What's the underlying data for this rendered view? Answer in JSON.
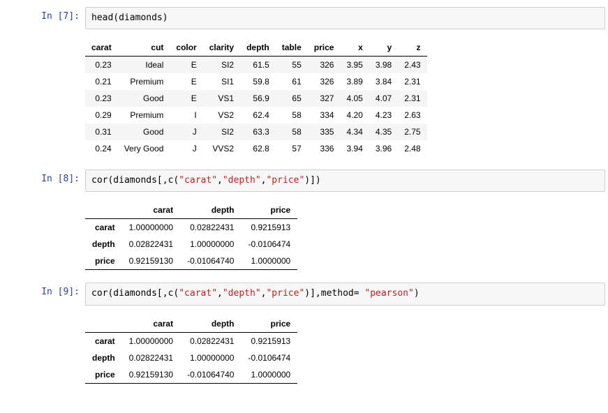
{
  "cells": [
    {
      "prompt": "In  [7]:",
      "code_plain": "head(diamonds)",
      "code_html": "head(diamonds)",
      "output_kind": "df",
      "df": {
        "headers": [
          "carat",
          "cut",
          "color",
          "clarity",
          "depth",
          "table",
          "price",
          "x",
          "y",
          "z"
        ],
        "rows": [
          [
            "0.23",
            "Ideal",
            "E",
            "SI2",
            "61.5",
            "55",
            "326",
            "3.95",
            "3.98",
            "2.43"
          ],
          [
            "0.21",
            "Premium",
            "E",
            "SI1",
            "59.8",
            "61",
            "326",
            "3.89",
            "3.84",
            "2.31"
          ],
          [
            "0.23",
            "Good",
            "E",
            "VS1",
            "56.9",
            "65",
            "327",
            "4.05",
            "4.07",
            "2.31"
          ],
          [
            "0.29",
            "Premium",
            "I",
            "VS2",
            "62.4",
            "58",
            "334",
            "4.20",
            "4.23",
            "2.63"
          ],
          [
            "0.31",
            "Good",
            "J",
            "SI2",
            "63.3",
            "58",
            "335",
            "4.34",
            "4.35",
            "2.75"
          ],
          [
            "0.24",
            "Very Good",
            "J",
            "VVS2",
            "62.8",
            "57",
            "336",
            "3.94",
            "3.96",
            "2.48"
          ]
        ]
      }
    },
    {
      "prompt": "In  [8]:",
      "code_plain": "cor(diamonds[,c(\"carat\",\"depth\",\"price\")])",
      "code_html": "cor(diamonds[,c(<span class=\"code-str\">\"carat\"</span>,<span class=\"code-str\">\"depth\"</span>,<span class=\"code-str\">\"price\"</span>)])",
      "output_kind": "cor",
      "cor": {
        "headers": [
          "carat",
          "depth",
          "price"
        ],
        "rows": [
          {
            "label": "carat",
            "values": [
              "1.00000000",
              "0.02822431",
              "0.9215913"
            ]
          },
          {
            "label": "depth",
            "values": [
              "0.02822431",
              "1.00000000",
              "-0.0106474"
            ]
          },
          {
            "label": "price",
            "values": [
              "0.92159130",
              "-0.01064740",
              "1.0000000"
            ]
          }
        ]
      }
    },
    {
      "prompt": "In  [9]:",
      "code_plain": "cor(diamonds[,c(\"carat\",\"depth\",\"price\")],method= \"pearson\")",
      "code_html": "cor(diamonds[,c(<span class=\"code-str\">\"carat\"</span>,<span class=\"code-str\">\"depth\"</span>,<span class=\"code-str\">\"price\"</span>)],method= <span class=\"code-str\">\"pearson\"</span>)",
      "output_kind": "cor",
      "cor": {
        "headers": [
          "carat",
          "depth",
          "price"
        ],
        "rows": [
          {
            "label": "carat",
            "values": [
              "1.00000000",
              "0.02822431",
              "0.9215913"
            ]
          },
          {
            "label": "depth",
            "values": [
              "0.02822431",
              "1.00000000",
              "-0.0106474"
            ]
          },
          {
            "label": "price",
            "values": [
              "0.92159130",
              "-0.01064740",
              "1.0000000"
            ]
          }
        ]
      }
    }
  ]
}
